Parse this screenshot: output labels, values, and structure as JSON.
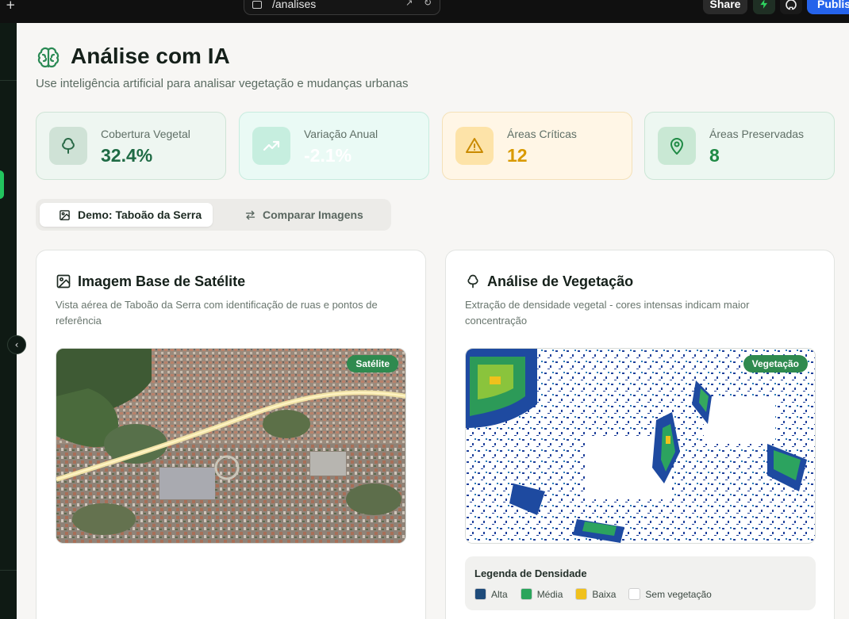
{
  "browser": {
    "new_tab_icon": "+",
    "url": "/analises",
    "share_label": "Share",
    "publish_label": "Publish"
  },
  "header": {
    "title": "Análise com IA",
    "subtitle": "Use inteligência artificial para analisar vegetação e mudanças urbanas"
  },
  "stats": [
    {
      "label": "Cobertura Vegetal",
      "value": "32.4%",
      "icon": "tree-icon",
      "color": "#1f6b45"
    },
    {
      "label": "Variação Anual",
      "value": "-2.1%",
      "icon": "trending-up-icon",
      "color": "#ffffff"
    },
    {
      "label": "Áreas Críticas",
      "value": "12",
      "icon": "alert-triangle-icon",
      "color": "#d99a00"
    },
    {
      "label": "Áreas Preservadas",
      "value": "8",
      "icon": "map-pin-icon",
      "color": "#1f8a45"
    }
  ],
  "tabs": [
    {
      "label": "Demo: Taboão da Serra",
      "icon": "image-icon",
      "active": true
    },
    {
      "label": "Comparar Imagens",
      "icon": "swap-icon",
      "active": false
    }
  ],
  "satellite_panel": {
    "title": "Imagem Base de Satélite",
    "description": "Vista aérea de Taboão da Serra com identificação de ruas e pontos de referência",
    "badge": "Satélite"
  },
  "vegetation_panel": {
    "title": "Análise de Vegetação",
    "description": "Extração de densidade vegetal - cores intensas indicam maior concentração",
    "badge": "Vegetação",
    "legend": {
      "title": "Legenda de Densidade",
      "items": [
        {
          "label": "Alta",
          "color": "#1e4b7a"
        },
        {
          "label": "Média",
          "color": "#2ba55c"
        },
        {
          "label": "Baixa",
          "color": "#f0c11c"
        },
        {
          "label": "Sem vegetação",
          "color": "#ffffff"
        }
      ]
    }
  }
}
